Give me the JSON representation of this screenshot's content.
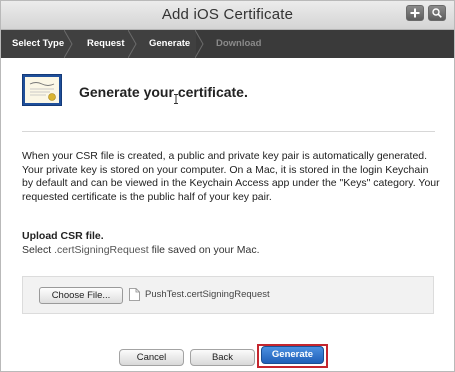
{
  "window": {
    "title": "Add iOS Certificate"
  },
  "steps": [
    {
      "label": "Select Type",
      "state": "done"
    },
    {
      "label": "Request",
      "state": "done"
    },
    {
      "label": "Generate",
      "state": "current"
    },
    {
      "label": "Download",
      "state": "future"
    }
  ],
  "main": {
    "heading": "Generate your certificate.",
    "paragraph": "When your CSR file is created, a public and private key pair is automatically generated. Your private key is stored on your computer. On a Mac, it is stored in the login Keychain by default and can be viewed in the Keychain Access app under the \"Keys\" category. Your requested certificate is the public half of your key pair.",
    "upload_title": "Upload CSR file.",
    "upload_desc_prefix": "Select ",
    "upload_desc_code": ".certSigningRequest",
    "upload_desc_suffix": " file saved on your Mac.",
    "choose_file_label": "Choose File...",
    "file_name": "PushTest.certSigningRequest"
  },
  "footer": {
    "cancel_label": "Cancel",
    "back_label": "Back",
    "generate_label": "Generate"
  },
  "icons": {
    "certificate": "certificate-icon",
    "plus": "plus-icon",
    "search": "search-icon",
    "file": "file-icon",
    "cursor": "text-cursor-icon"
  },
  "colors": {
    "steps_bar": "#404040",
    "primary_button": "#2a6bc4",
    "highlight": "#c4262e"
  }
}
